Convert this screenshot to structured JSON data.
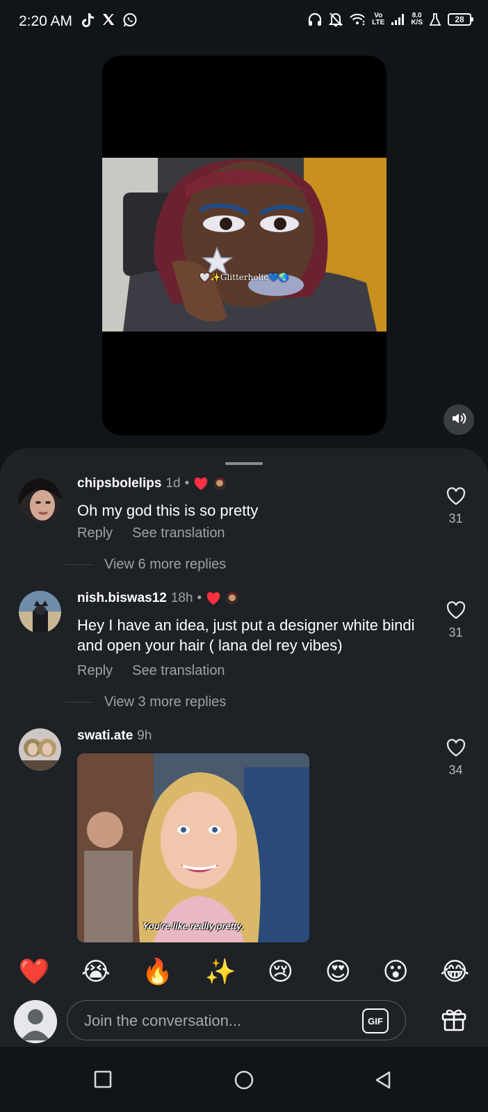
{
  "status_bar": {
    "time": "2:20 AM",
    "network_top": "Vo",
    "network_bottom": "LTE",
    "speed_top": "8.0",
    "speed_bottom": "K/S",
    "battery": "28",
    "icons": [
      "tiktok-icon",
      "x-icon",
      "whatsapp-icon",
      "headphones-icon",
      "bell-off-icon",
      "wifi-icon",
      "signal-icon",
      "flask-icon"
    ]
  },
  "video": {
    "watermark": "🤍✨Glitterholic💙🌏"
  },
  "comments": [
    {
      "user": "chipsbolelips",
      "time": "1d",
      "dot": "•",
      "text": "Oh my god this is so pretty",
      "reply": "Reply",
      "translate": "See translation",
      "likes": "31",
      "view_replies": "View 6 more replies"
    },
    {
      "user": "nish.biswas12",
      "time": "18h",
      "dot": "•",
      "text": "Hey I have an idea, just put a designer white bindi and open your hair ( lana del rey vibes)",
      "reply": "Reply",
      "translate": "See translation",
      "likes": "31",
      "view_replies": "View 3 more replies"
    },
    {
      "user": "swati.ate",
      "time": "9h",
      "likes": "34",
      "gif_caption": "You're like really pretty."
    }
  ],
  "emoji_bar": [
    "❤️",
    "😭",
    "🔥",
    "✨",
    "😢",
    "😍",
    "😮",
    "😂"
  ],
  "composer": {
    "placeholder": "Join the conversation...",
    "gif_label": "GIF"
  },
  "colors": {
    "background": "#111419",
    "sheet": "#1e2126",
    "like_red": "#ff3040",
    "muted_text": "#9ea1a6"
  }
}
